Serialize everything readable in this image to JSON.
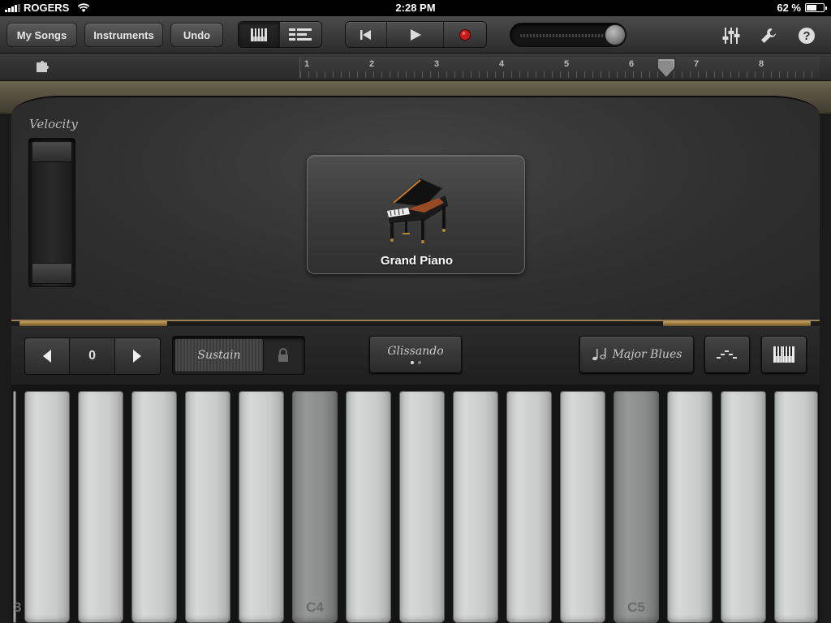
{
  "status": {
    "carrier": "ROGERS",
    "time": "2:28 PM",
    "battery_text": "62 %",
    "battery_level": 0.62
  },
  "toolbar": {
    "my_songs": "My Songs",
    "instruments": "Instruments",
    "undo": "Undo",
    "views": [
      "keyboard-view-icon",
      "tracks-view-icon"
    ],
    "transport": [
      "go-to-start-icon",
      "play-icon",
      "record-icon"
    ],
    "volume_level": 0.92,
    "right_icons": [
      "mixer-icon",
      "wrench-icon",
      "help-icon"
    ],
    "record_color": "#c81c1c"
  },
  "ruler": {
    "numbers": [
      "1",
      "2",
      "3",
      "4",
      "5",
      "6",
      "7",
      "8"
    ]
  },
  "panel": {
    "velocity_label": "Velocity",
    "instrument_name": "Grand Piano"
  },
  "controls": {
    "octave_value": "0",
    "sustain_label": "Sustain",
    "glissando_label": "Glissando",
    "scale_label": "Major Blues"
  },
  "keys": {
    "labels": [
      "3",
      "",
      "",
      "",
      "",
      "",
      "C4",
      "",
      "",
      "",
      "",
      "",
      "C5",
      "",
      "",
      ""
    ],
    "pressed": [
      false,
      false,
      false,
      false,
      false,
      false,
      true,
      false,
      false,
      false,
      false,
      false,
      true,
      false,
      false,
      false
    ]
  }
}
